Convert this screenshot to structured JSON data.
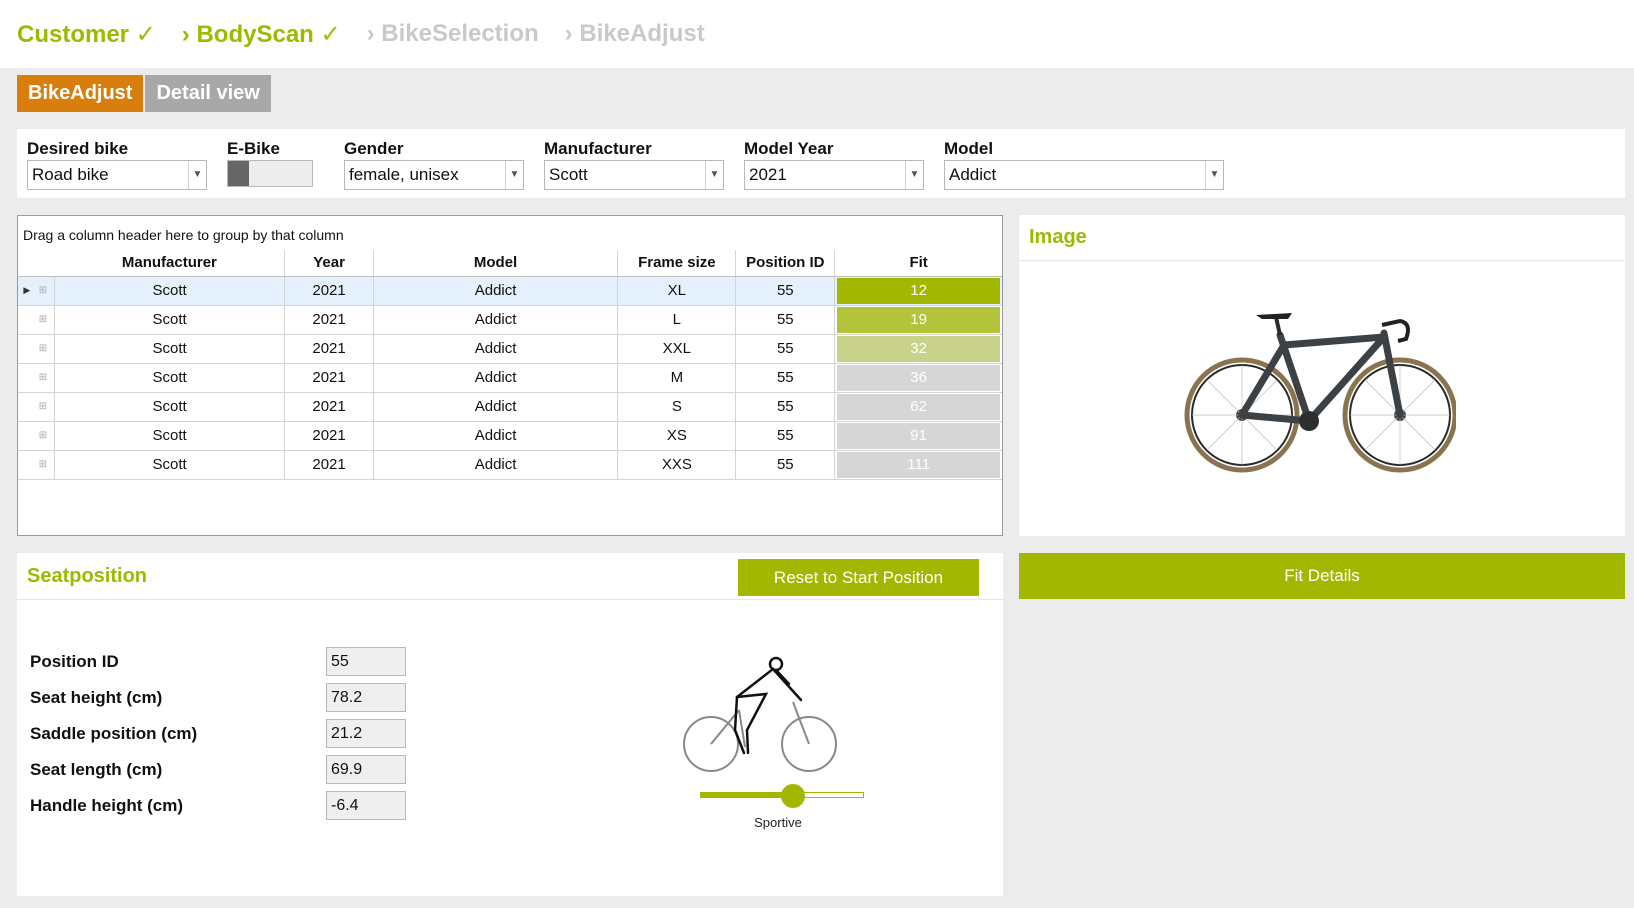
{
  "breadcrumb": [
    {
      "label": "Customer ✓",
      "state": "done"
    },
    {
      "label": "› BodyScan ✓",
      "state": "done"
    },
    {
      "label": "› BikeSelection",
      "state": "todo"
    },
    {
      "label": "› BikeAdjust",
      "state": "todo"
    }
  ],
  "tabs": [
    {
      "label": "BikeAdjust",
      "active": true
    },
    {
      "label": "Detail view",
      "active": false
    }
  ],
  "filters": {
    "desired_bike": {
      "label": "Desired bike",
      "value": "Road bike"
    },
    "ebike": {
      "label": "E-Bike",
      "on": false
    },
    "gender": {
      "label": "Gender",
      "value": "female, unisex"
    },
    "manufacturer": {
      "label": "Manufacturer",
      "value": "Scott"
    },
    "model_year": {
      "label": "Model Year",
      "value": "2021"
    },
    "model": {
      "label": "Model",
      "value": "Addict"
    }
  },
  "grid": {
    "group_hint": "Drag a column header here to group by that column",
    "columns": [
      "Manufacturer",
      "Year",
      "Model",
      "Frame size",
      "Position ID",
      "Fit"
    ],
    "rows": [
      {
        "manufacturer": "Scott",
        "year": "2021",
        "model": "Addict",
        "frame": "XL",
        "position": "55",
        "fit": "12",
        "fit_color": "#a2b800"
      },
      {
        "manufacturer": "Scott",
        "year": "2021",
        "model": "Addict",
        "frame": "L",
        "position": "55",
        "fit": "19",
        "fit_color": "#b3c43a"
      },
      {
        "manufacturer": "Scott",
        "year": "2021",
        "model": "Addict",
        "frame": "XXL",
        "position": "55",
        "fit": "32",
        "fit_color": "#c9d28a"
      },
      {
        "manufacturer": "Scott",
        "year": "2021",
        "model": "Addict",
        "frame": "M",
        "position": "55",
        "fit": "36",
        "fit_color": "#d6d6d6"
      },
      {
        "manufacturer": "Scott",
        "year": "2021",
        "model": "Addict",
        "frame": "S",
        "position": "55",
        "fit": "62",
        "fit_color": "#d6d6d6"
      },
      {
        "manufacturer": "Scott",
        "year": "2021",
        "model": "Addict",
        "frame": "XS",
        "position": "55",
        "fit": "91",
        "fit_color": "#d6d6d6"
      },
      {
        "manufacturer": "Scott",
        "year": "2021",
        "model": "Addict",
        "frame": "XXS",
        "position": "55",
        "fit": "111",
        "fit_color": "#d6d6d6"
      }
    ]
  },
  "image_panel": {
    "title": "Image"
  },
  "seat": {
    "title": "Seatposition",
    "reset_label": "Reset to Start Position",
    "fields": [
      {
        "label": "Position ID",
        "value": "55"
      },
      {
        "label": "Seat height (cm)",
        "value": "78.2"
      },
      {
        "label": "Saddle position (cm)",
        "value": "21.2"
      },
      {
        "label": "Seat length (cm)",
        "value": "69.9"
      },
      {
        "label": "Handle height (cm)",
        "value": "-6.4"
      }
    ],
    "slider_label": "Sportive",
    "slider_level": 0.57
  },
  "fit_details_label": "Fit Details",
  "colors": {
    "accent": "#a2b800",
    "tab_active": "#d77e0c",
    "tab_inactive": "#a8a8a8"
  }
}
